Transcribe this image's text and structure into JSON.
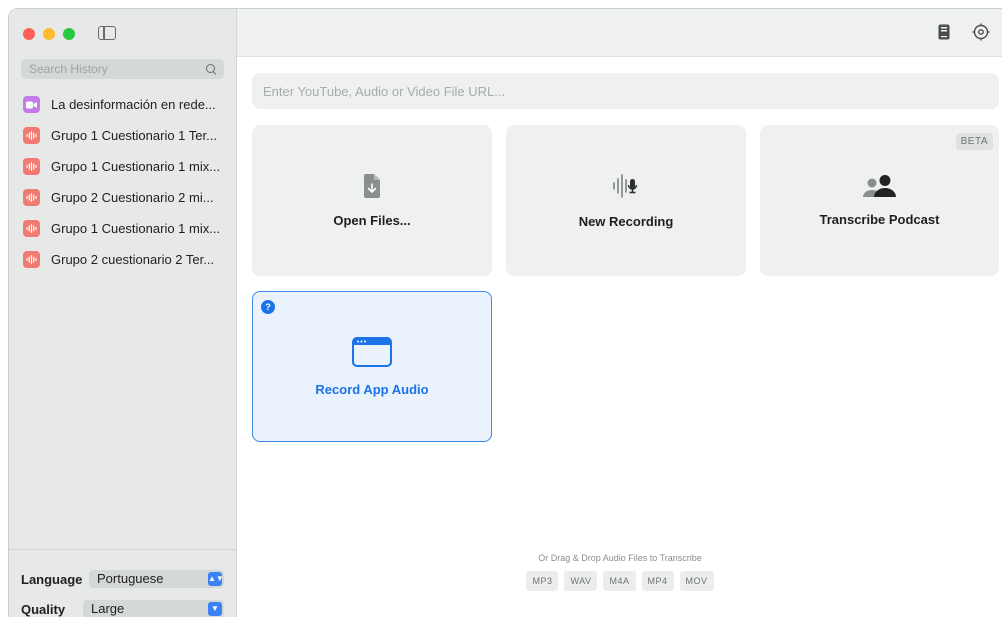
{
  "sidebar": {
    "search_placeholder": "Search History",
    "history": [
      {
        "label": "La desinformación en rede...",
        "type": "video"
      },
      {
        "label": "Grupo 1 Cuestionario 1 Ter...",
        "type": "audio"
      },
      {
        "label": "Grupo 1 Cuestionario 1 mix...",
        "type": "audio"
      },
      {
        "label": "Grupo 2 Cuestionario 2 mi...",
        "type": "audio"
      },
      {
        "label": "Grupo 1 Cuestionario 1 mix...",
        "type": "audio"
      },
      {
        "label": "Grupo 2 cuestionario 2 Ter...",
        "type": "audio"
      }
    ],
    "language_label": "Language",
    "language_value": "Portuguese",
    "quality_label": "Quality",
    "quality_value": "Large"
  },
  "main": {
    "url_placeholder": "Enter YouTube, Audio or Video File URL...",
    "cards": {
      "open_files": "Open Files...",
      "new_recording": "New Recording",
      "transcribe_podcast": "Transcribe Podcast",
      "beta_badge": "BETA",
      "record_app_audio": "Record App Audio",
      "help_badge": "?"
    },
    "drop_hint": "Or Drag & Drop Audio Files to Transcribe",
    "formats": [
      "MP3",
      "WAV",
      "M4A",
      "MP4",
      "MOV"
    ]
  },
  "colors": {
    "accent": "#1a73e8",
    "video_icon": "#c27ce8",
    "audio_icon": "#f17a72"
  }
}
